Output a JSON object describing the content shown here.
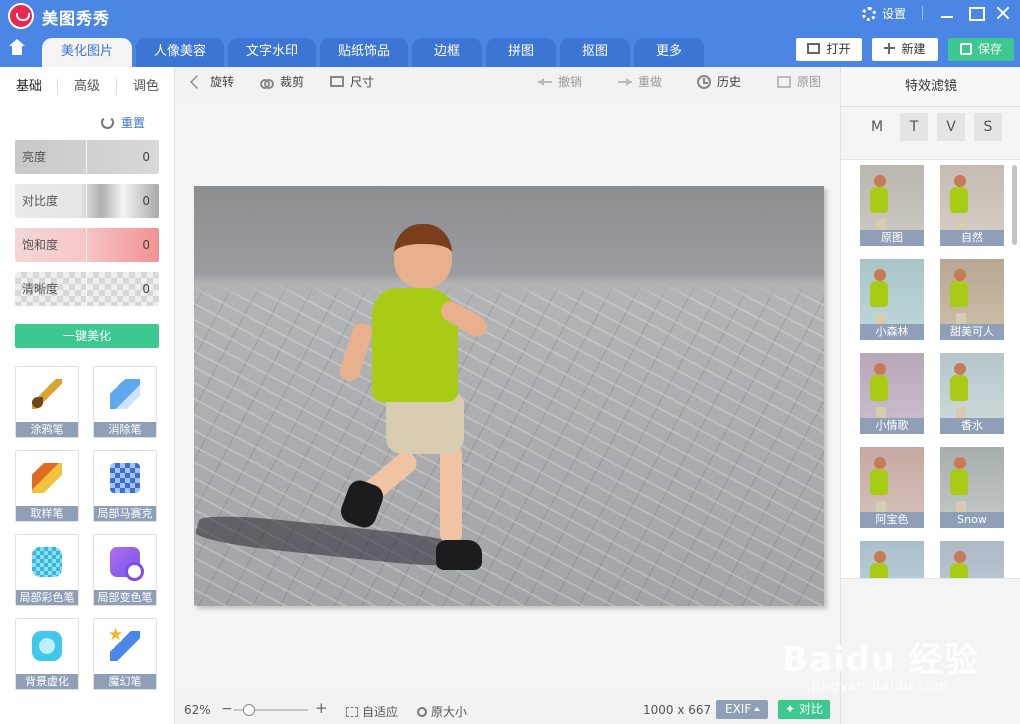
{
  "app": {
    "title": "美图秀秀",
    "settings_label": "设置"
  },
  "colors": {
    "header": "#4b86e4",
    "accent_green": "#3dc88f",
    "label_bg": "#8f9fb8"
  },
  "tabs": [
    "美化图片",
    "人像美容",
    "文字水印",
    "贴纸饰品",
    "边框",
    "拼图",
    "抠图",
    "更多"
  ],
  "actions": {
    "open": "打开",
    "new": "新建",
    "save": "保存"
  },
  "left_panel": {
    "subtabs": [
      "基础",
      "高级",
      "调色"
    ],
    "reset_label": "重置",
    "sliders": [
      {
        "label": "亮度",
        "value": "0"
      },
      {
        "label": "对比度",
        "value": "0"
      },
      {
        "label": "饱和度",
        "value": "0"
      },
      {
        "label": "清晰度",
        "value": "0"
      }
    ],
    "one_click": "一键美化",
    "tools": [
      "涂鸦笔",
      "消除笔",
      "取样笔",
      "局部马赛克",
      "局部彩色笔",
      "局部变色笔",
      "背景虚化",
      "魔幻笔"
    ]
  },
  "toolbar": {
    "rotate": "旋转",
    "crop": "裁剪",
    "size": "尺寸",
    "undo": "撤销",
    "redo": "重做",
    "history": "历史",
    "original": "原图"
  },
  "status": {
    "zoom": "62%",
    "zoom_level": 0.2,
    "fit": "自适应",
    "actual_size": "原大小",
    "dimensions": "1000 x 667",
    "exif": "EXIF",
    "compare": "对比"
  },
  "right_panel": {
    "title": "特效滤镜",
    "modes": [
      "M",
      "T",
      "V",
      "S"
    ],
    "filters": [
      "原图",
      "自然",
      "小森林",
      "甜美可人",
      "小情歌",
      "香水",
      "阿宝色",
      "Snow"
    ]
  },
  "watermark": {
    "main": "Baidu 经验",
    "sub": "jingyan.baidu.com"
  }
}
